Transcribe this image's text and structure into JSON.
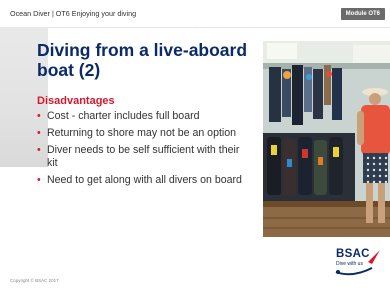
{
  "header": {
    "course_info": "Ocean Diver  |  OT6 Enjoying your diving",
    "module_badge": "Module OT6"
  },
  "slide": {
    "title": "Diving from a live-aboard boat (2)",
    "subheading": "Disadvantages",
    "bullets": [
      "Cost - charter includes full board",
      "Returning to shore may not be an option",
      "Diver needs to be self sufficient with their kit",
      "Need to get along with all divers on board"
    ]
  },
  "footer": {
    "copyright": "Copyright © BSAC 2017",
    "logo_text": "BSAC",
    "logo_tagline": "Dive with us"
  },
  "colors": {
    "title": "#0b2a6a",
    "accent_red": "#d21a2f",
    "body_text": "#333333",
    "badge_bg": "#6b6b6b"
  },
  "icons": {
    "bullet": "bullet-dot-icon",
    "logo_swoosh": "bsac-swoosh-icon"
  }
}
